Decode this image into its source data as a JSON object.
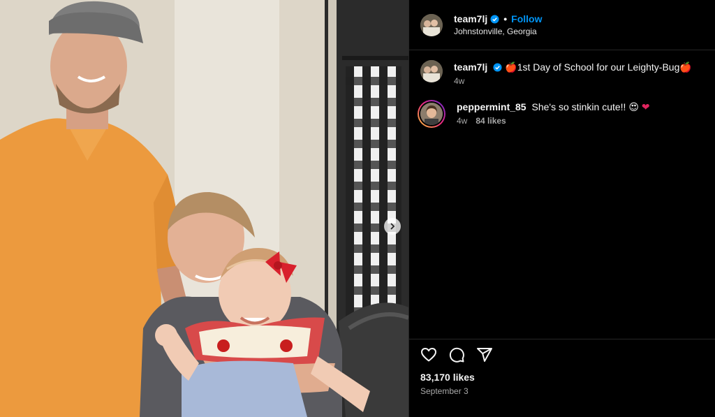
{
  "post": {
    "author": {
      "username": "team7lj",
      "verified": true,
      "location": "Johnstonville, Georgia"
    },
    "follow_label": "Follow",
    "separator": "•",
    "caption": {
      "username": "team7lj",
      "emoji_start": "🍎",
      "text": "1st Day of School for our Leighty-Bug",
      "emoji_end": "🍎",
      "time": "4w"
    },
    "comments": [
      {
        "username": "peppermint_85",
        "text": "She's so stinkin cute!!",
        "emojis": [
          "😍",
          "❤"
        ],
        "time": "4w",
        "likes": "84 likes"
      }
    ],
    "likes": "83,170 likes",
    "date": "September 3",
    "icons": {
      "like": "heart-icon",
      "comment": "comment-icon",
      "share": "paper-plane-icon",
      "next": "chevron-right-icon",
      "verified": "verified-badge-icon"
    },
    "colors": {
      "accent": "#0095f6",
      "background": "#000000",
      "verified": "#0095f6"
    }
  }
}
